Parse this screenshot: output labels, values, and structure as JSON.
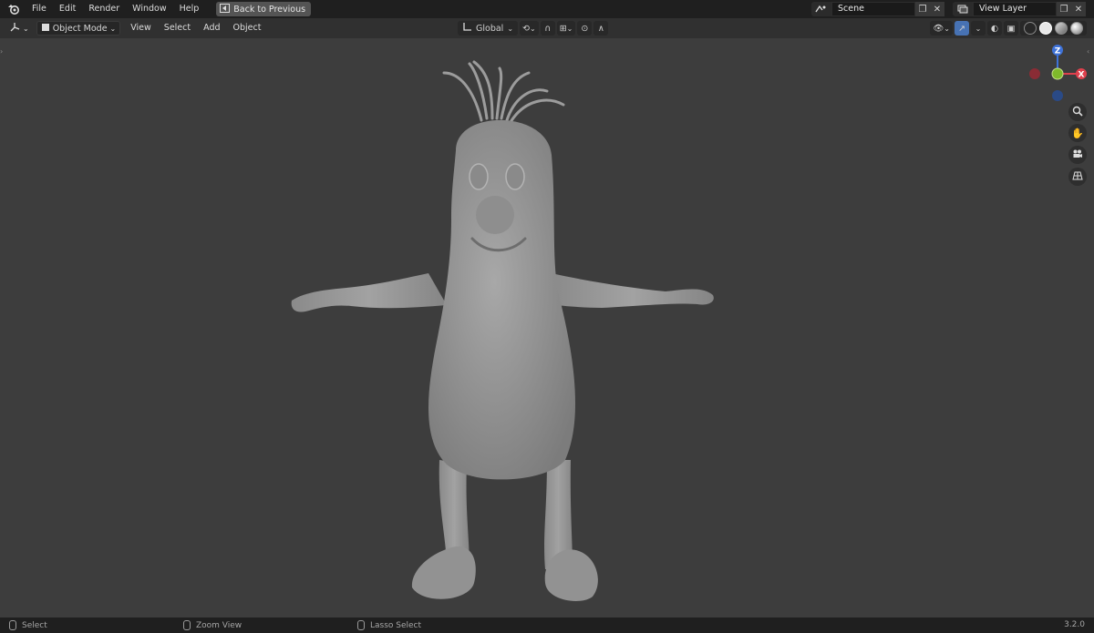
{
  "menu": {
    "items": [
      "File",
      "Edit",
      "Render",
      "Window",
      "Help"
    ]
  },
  "topbar": {
    "back_label": "Back to Previous",
    "scene_label": "Scene",
    "view_layer_label": "View Layer"
  },
  "viewport_header": {
    "mode_label": "Object Mode",
    "menus": [
      "View",
      "Select",
      "Add",
      "Object"
    ],
    "orientation_label": "Global"
  },
  "gizmo": {
    "z_label": "Z",
    "x_label": "X"
  },
  "statusbar": {
    "select": "Select",
    "zoom": "Zoom View",
    "lasso": "Lasso Select",
    "version": "3.2.0"
  },
  "colors": {
    "viewport_bg": "#3d3d3d",
    "accent": "#4772b3",
    "axis_x": "#e0404d",
    "axis_y": "#7fb92b",
    "axis_z": "#3e72d8",
    "model": "#9a9a9a"
  }
}
